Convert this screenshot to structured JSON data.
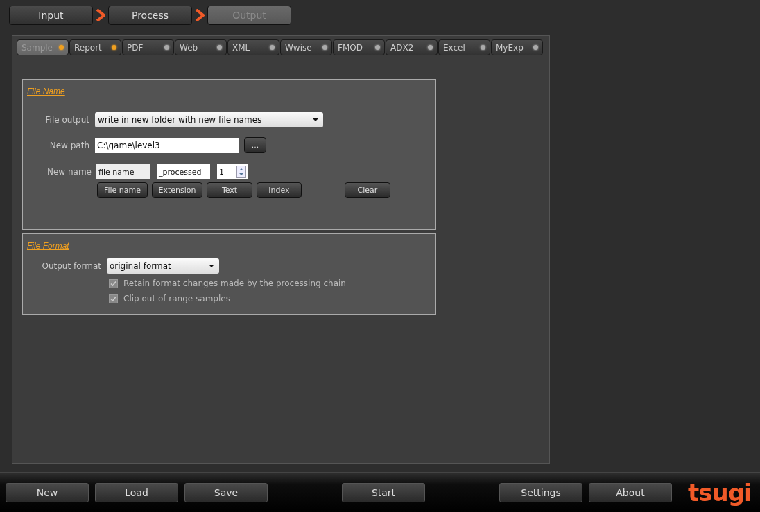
{
  "steps": [
    {
      "label": "Input",
      "selected": false
    },
    {
      "label": "Process",
      "selected": false
    },
    {
      "label": "Output",
      "selected": true
    }
  ],
  "tabs": [
    {
      "label": "Sample",
      "selected": true,
      "active": true
    },
    {
      "label": "Report",
      "selected": false,
      "active": true
    },
    {
      "label": "PDF",
      "selected": false,
      "active": false
    },
    {
      "label": "Web",
      "selected": false,
      "active": false
    },
    {
      "label": "XML",
      "selected": false,
      "active": false
    },
    {
      "label": "Wwise",
      "selected": false,
      "active": false
    },
    {
      "label": "FMOD",
      "selected": false,
      "active": false
    },
    {
      "label": "ADX2",
      "selected": false,
      "active": false
    },
    {
      "label": "Excel",
      "selected": false,
      "active": false
    },
    {
      "label": "MyExp",
      "selected": false,
      "active": false
    }
  ],
  "file_name": {
    "title": "File Name",
    "file_output_label": "File output",
    "file_output_value": "write in new folder with new file names",
    "new_path_label": "New path",
    "new_path_value": "C:\\game\\level3",
    "browse_button": "...",
    "new_name_label": "New name",
    "name_parts": [
      "file name",
      "_processed"
    ],
    "index_value": "1",
    "part_buttons": [
      "File name",
      "Extension",
      "Text",
      "Index"
    ],
    "clear_button": "Clear"
  },
  "file_format": {
    "title": "File Format",
    "output_format_label": "Output format",
    "output_format_value": "original format",
    "options": [
      {
        "label": "Retain format changes made by the processing chain",
        "checked": true,
        "disabled": true
      },
      {
        "label": "Clip out of range samples",
        "checked": true,
        "disabled": true
      }
    ]
  },
  "bottom_bar": {
    "left_buttons": [
      "New",
      "Load",
      "Save"
    ],
    "center_button": "Start",
    "right_buttons": [
      "Settings",
      "About"
    ],
    "logo": "tsugi"
  }
}
